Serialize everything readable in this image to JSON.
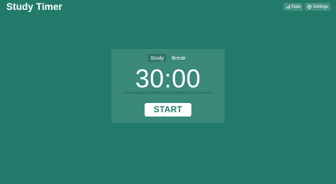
{
  "header": {
    "title": "Study Timer",
    "actions": [
      {
        "label": "Stats",
        "icon": "bar-chart-icon"
      },
      {
        "label": "Settings",
        "icon": "gear-icon"
      }
    ]
  },
  "timer": {
    "modes": [
      {
        "label": "Study",
        "active": true
      },
      {
        "label": "Break",
        "active": false
      }
    ],
    "time": "30:00",
    "progress": 0,
    "start_label": "START"
  },
  "colors": {
    "background": "#227b6a",
    "accent": "#ffffff"
  }
}
